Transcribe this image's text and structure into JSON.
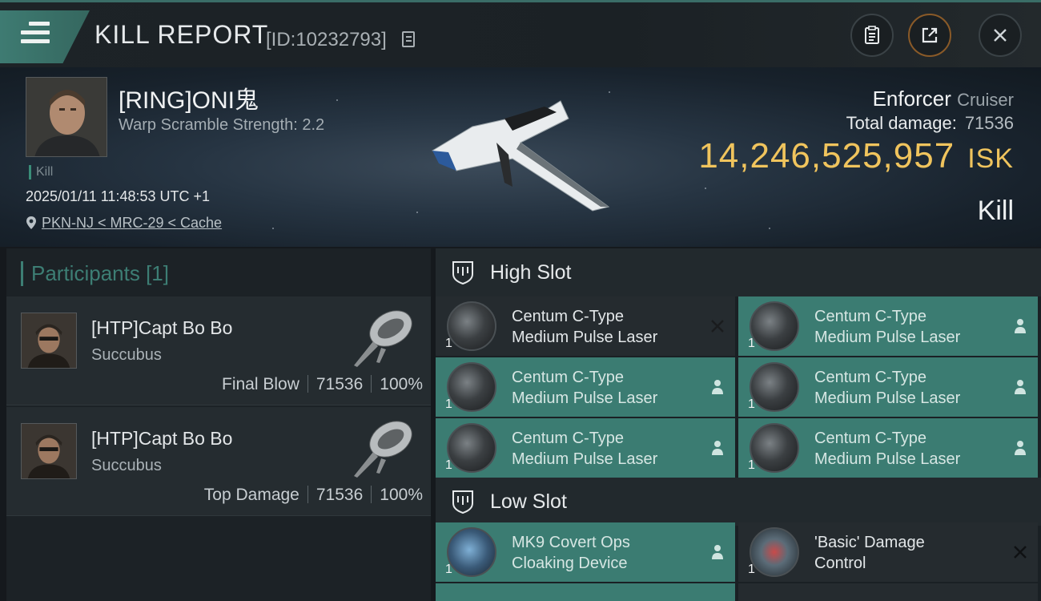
{
  "header": {
    "title": "KILL REPORT",
    "report_id": "[ID:10232793]"
  },
  "victim": {
    "pilot_name": "[RING]ONI鬼",
    "warp_scramble": "Warp Scramble Strength: 2.2",
    "tag": "Kill",
    "datetime": "2025/01/11 11:48:53 UTC +1",
    "location": "PKN-NJ < MRC-29 < Cache",
    "ship_name": "Enforcer",
    "ship_class": "Cruiser",
    "total_damage_label": "Total damage:",
    "total_damage": "71536",
    "isk_value": "14,246,525,957",
    "isk_unit": "ISK",
    "result": "Kill"
  },
  "participants": {
    "heading": "Participants [1]",
    "items": [
      {
        "name": "[HTP]Capt Bo Bo",
        "ship": "Succubus",
        "role": "Final Blow",
        "damage": "71536",
        "percent": "100%"
      },
      {
        "name": "[HTP]Capt Bo Bo",
        "ship": "Succubus",
        "role": "Top Damage",
        "damage": "71536",
        "percent": "100%"
      }
    ]
  },
  "slots": {
    "high": {
      "label": "High Slot",
      "modules": [
        {
          "line1": "Centum C-Type",
          "line2": "Medium Pulse Laser",
          "qty": "1",
          "state": "destroyed"
        },
        {
          "line1": "Centum C-Type",
          "line2": "Medium Pulse Laser",
          "qty": "1",
          "state": "dropped"
        },
        {
          "line1": "Centum C-Type",
          "line2": "Medium Pulse Laser",
          "qty": "1",
          "state": "dropped"
        },
        {
          "line1": "Centum C-Type",
          "line2": "Medium Pulse Laser",
          "qty": "1",
          "state": "dropped"
        },
        {
          "line1": "Centum C-Type",
          "line2": "Medium Pulse Laser",
          "qty": "1",
          "state": "dropped"
        },
        {
          "line1": "Centum C-Type",
          "line2": "Medium Pulse Laser",
          "qty": "1",
          "state": "dropped"
        }
      ]
    },
    "low": {
      "label": "Low Slot",
      "modules": [
        {
          "line1": "MK9 Covert Ops",
          "line2": "Cloaking Device",
          "qty": "1",
          "state": "dropped"
        },
        {
          "line1": "'Basic' Damage",
          "line2": "Control",
          "qty": "1",
          "state": "destroyed"
        }
      ]
    }
  },
  "colors": {
    "accent_teal": "#3b7c72",
    "isk_gold": "#f0c45d"
  }
}
